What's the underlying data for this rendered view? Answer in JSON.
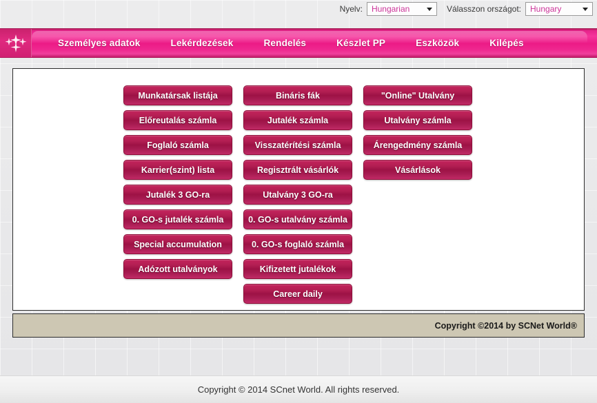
{
  "topbar": {
    "language_label": "Nyelv:",
    "language_value": "Hungarian",
    "country_label": "Válasszon országot:",
    "country_value": "Hungary"
  },
  "nav": {
    "logo_icon": "sparkle-logo-icon",
    "items": [
      {
        "label": "Személyes adatok"
      },
      {
        "label": "Lekérdezések"
      },
      {
        "label": "Rendelés"
      },
      {
        "label": "Készlet PP"
      },
      {
        "label": "Eszközök"
      },
      {
        "label": "Kilépés"
      }
    ]
  },
  "main": {
    "columns": [
      {
        "buttons": [
          {
            "label": "Munkatársak listája"
          },
          {
            "label": "Előreutalás számla"
          },
          {
            "label": "Foglaló számla"
          },
          {
            "label": "Karrier(szint) lista"
          },
          {
            "label": "Jutalék 3 GO-ra"
          },
          {
            "label": "0. GO-s jutalék számla"
          },
          {
            "label": "Special accumulation"
          },
          {
            "label": "Adózott utalványok"
          }
        ]
      },
      {
        "buttons": [
          {
            "label": "Bináris fák"
          },
          {
            "label": "Jutalék számla"
          },
          {
            "label": "Visszatérítési számla"
          },
          {
            "label": "Regisztrált vásárlók"
          },
          {
            "label": "Utalvány 3 GO-ra"
          },
          {
            "label": "0. GO-s utalvány számla"
          },
          {
            "label": "0. GO-s foglaló számla"
          },
          {
            "label": "Kifizetett jutalékok"
          },
          {
            "label": "Career daily"
          }
        ]
      },
      {
        "buttons": [
          {
            "label": "\"Online\" Utalvány"
          },
          {
            "label": "Utalvány számla"
          },
          {
            "label": "Árengedmény számla"
          },
          {
            "label": "Vásárlások"
          }
        ]
      }
    ]
  },
  "inner_footer": {
    "copyright": "Copyright ©2014 by SCNet World®"
  },
  "page_footer": {
    "copyright": "Copyright © 2014 SCnet World. All rights reserved."
  },
  "colors": {
    "nav_pink": "#ec1b86",
    "button_crimson": "#9d1245",
    "select_text": "#cc3399",
    "inner_footer_beige": "#cdc7b3"
  }
}
